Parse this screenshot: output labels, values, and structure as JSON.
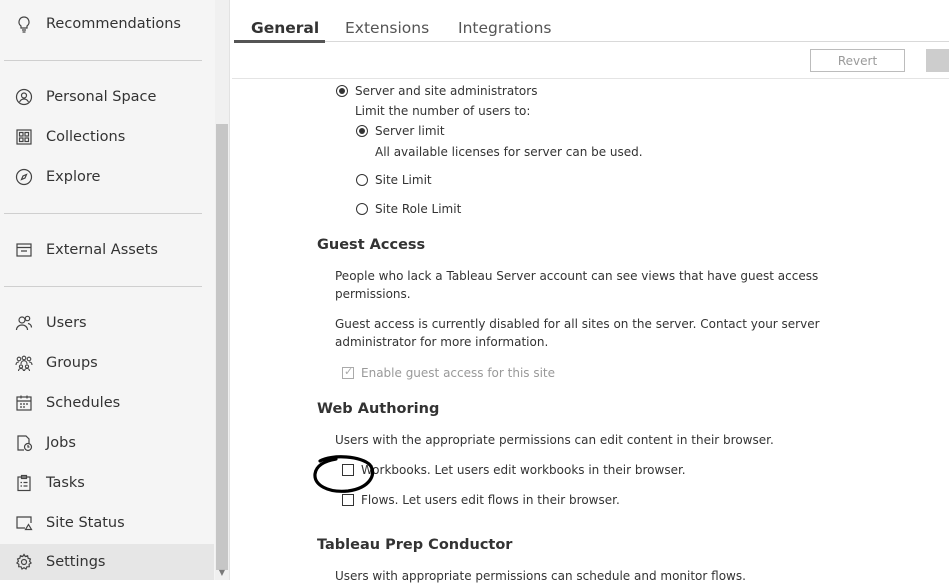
{
  "sidebar": {
    "items": [
      {
        "label": "Recommendations",
        "icon": "lightbulb-icon"
      },
      {
        "label": "Personal Space",
        "icon": "person-circle-icon"
      },
      {
        "label": "Collections",
        "icon": "collections-grid-icon"
      },
      {
        "label": "Explore",
        "icon": "compass-icon"
      },
      {
        "label": "External Assets",
        "icon": "external-assets-icon"
      },
      {
        "label": "Users",
        "icon": "users-icon"
      },
      {
        "label": "Groups",
        "icon": "groups-icon"
      },
      {
        "label": "Schedules",
        "icon": "calendar-icon"
      },
      {
        "label": "Jobs",
        "icon": "jobs-clock-icon"
      },
      {
        "label": "Tasks",
        "icon": "clipboard-icon"
      },
      {
        "label": "Site Status",
        "icon": "site-status-icon"
      },
      {
        "label": "Settings",
        "icon": "gear-icon",
        "active": true
      }
    ]
  },
  "tabs": [
    {
      "label": "General",
      "active": true
    },
    {
      "label": "Extensions"
    },
    {
      "label": "Integrations"
    }
  ],
  "toolbar": {
    "revert_label": "Revert"
  },
  "user_limit": {
    "server_site_admins": "Server and site administrators",
    "limit_label": "Limit the number of users to:",
    "server_limit": "Server limit",
    "server_limit_desc": "All available licenses for server can be used.",
    "site_limit": "Site Limit",
    "site_role_limit": "Site Role Limit"
  },
  "guest_access": {
    "heading": "Guest Access",
    "desc_line1": "People who lack a Tableau Server account can see views that have guest access",
    "desc_line2": "permissions.",
    "note_line1": "Guest access is currently disabled for all sites on the server. Contact your server",
    "note_line2": "administrator for more information.",
    "checkbox_label": "Enable guest access for this site"
  },
  "web_authoring": {
    "heading": "Web Authoring",
    "desc": "Users with the appropriate permissions can edit content in their browser.",
    "workbooks_label": "Workbooks. Let users edit workbooks in their browser.",
    "flows_label": "Flows. Let users edit flows in their browser."
  },
  "prep_conductor": {
    "heading": "Tableau Prep Conductor",
    "desc": "Users with appropriate permissions can schedule and monitor flows."
  },
  "colors": {
    "sidebar_bg": "#f5f5f5",
    "active_item_bg": "#e6e6e6",
    "text": "#333333",
    "muted": "#999999"
  }
}
